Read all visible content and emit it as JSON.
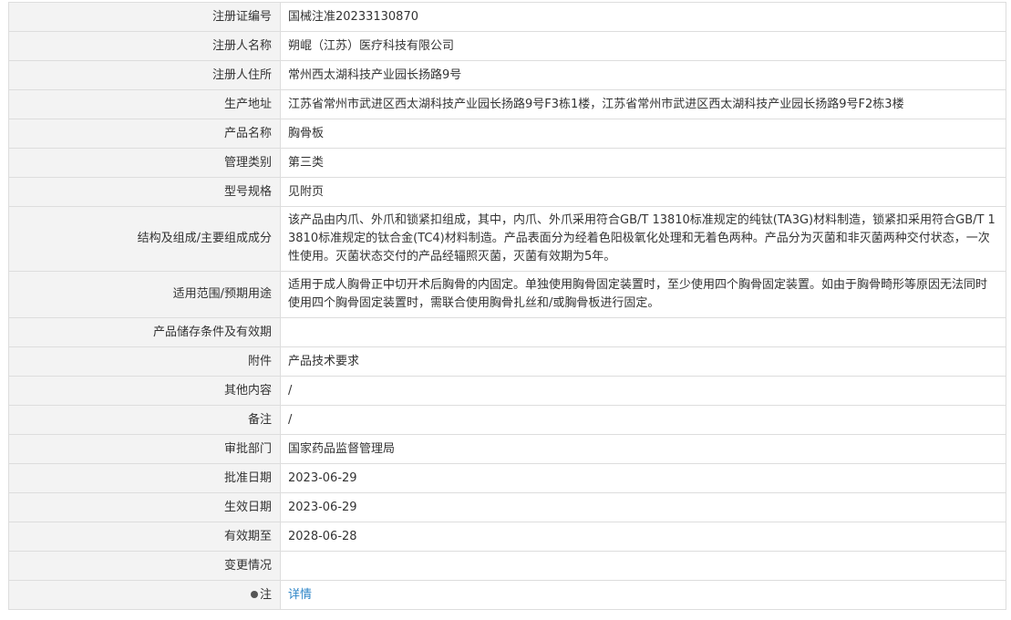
{
  "rows": [
    {
      "label": "注册证编号",
      "value": "国械注准20233130870"
    },
    {
      "label": "注册人名称",
      "value": "朔崐（江苏）医疗科技有限公司"
    },
    {
      "label": "注册人住所",
      "value": "常州西太湖科技产业园长扬路9号"
    },
    {
      "label": "生产地址",
      "value": "江苏省常州市武进区西太湖科技产业园长扬路9号F3栋1楼，江苏省常州市武进区西太湖科技产业园长扬路9号F2栋3楼"
    },
    {
      "label": "产品名称",
      "value": "胸骨板"
    },
    {
      "label": "管理类别",
      "value": "第三类"
    },
    {
      "label": "型号规格",
      "value": "见附页"
    },
    {
      "label": "结构及组成/主要组成成分",
      "value": "该产品由内爪、外爪和锁紧扣组成，其中，内爪、外爪采用符合GB/T 13810标准规定的纯钛(TA3G)材料制造，锁紧扣采用符合GB/T 13810标准规定的钛合金(TC4)材料制造。产品表面分为经着色阳极氧化处理和无着色两种。产品分为灭菌和非灭菌两种交付状态，一次性使用。灭菌状态交付的产品经辐照灭菌，灭菌有效期为5年。"
    },
    {
      "label": "适用范围/预期用途",
      "value": "适用于成人胸骨正中切开术后胸骨的内固定。单独使用胸骨固定装置时，至少使用四个胸骨固定装置。如由于胸骨畸形等原因无法同时使用四个胸骨固定装置时，需联合使用胸骨扎丝和/或胸骨板进行固定。"
    },
    {
      "label": "产品储存条件及有效期",
      "value": ""
    },
    {
      "label": "附件",
      "value": "产品技术要求"
    },
    {
      "label": "其他内容",
      "value": "/"
    },
    {
      "label": "备注",
      "value": "/"
    },
    {
      "label": "审批部门",
      "value": "国家药品监督管理局"
    },
    {
      "label": "批准日期",
      "value": "2023-06-29"
    },
    {
      "label": "生效日期",
      "value": "2023-06-29"
    },
    {
      "label": "有效期至",
      "value": "2028-06-28"
    },
    {
      "label": "变更情况",
      "value": ""
    }
  ],
  "note": {
    "label": "注",
    "link": "详情",
    "icon": "bulb-icon"
  },
  "colors": {
    "label_bg": "#f3f3f3",
    "border": "#dddddd",
    "link": "#2e86c8",
    "text": "#333333"
  }
}
